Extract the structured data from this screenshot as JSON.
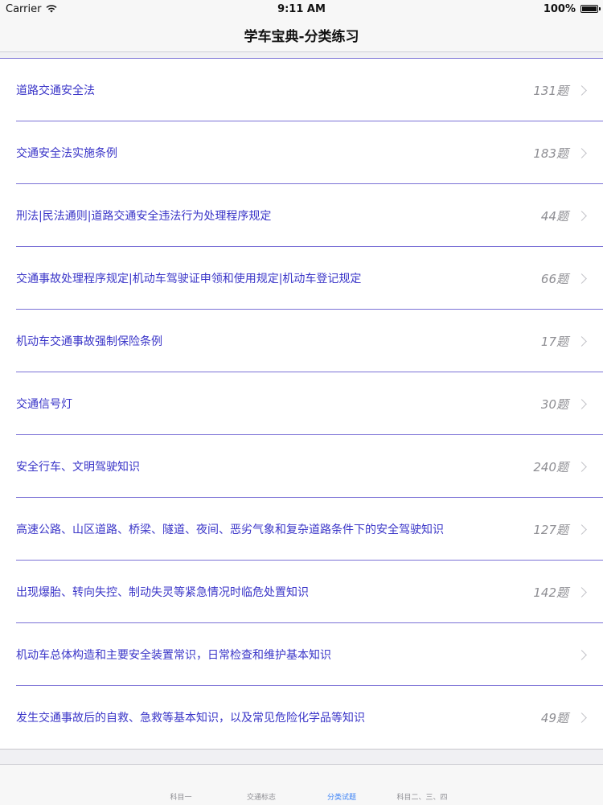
{
  "statusbar": {
    "carrier": "Carrier",
    "time": "9:11 AM",
    "battery": "100%"
  },
  "navbar": {
    "title": "学车宝典-分类练习"
  },
  "list": {
    "items": [
      {
        "label": "道路交通安全法",
        "count": "131题"
      },
      {
        "label": "交通安全法实施条例",
        "count": "183题"
      },
      {
        "label": "刑法|民法通则|道路交通安全违法行为处理程序规定",
        "count": "44题"
      },
      {
        "label": "交通事故处理程序规定|机动车驾驶证申领和使用规定|机动车登记规定",
        "count": "66题"
      },
      {
        "label": "机动车交通事故强制保险条例",
        "count": "17题"
      },
      {
        "label": "交通信号灯",
        "count": "30题"
      },
      {
        "label": "安全行车、文明驾驶知识",
        "count": "240题"
      },
      {
        "label": "高速公路、山区道路、桥梁、隧道、夜间、恶劣气象和复杂道路条件下的安全驾驶知识",
        "count": "127题"
      },
      {
        "label": "出现爆胎、转向失控、制动失灵等紧急情况时临危处置知识",
        "count": "142题"
      },
      {
        "label": "机动车总体构造和主要安全装置常识，日常检查和维护基本知识",
        "count": ""
      },
      {
        "label": "发生交通事故后的自救、急救等基本知识，以及常见危险化学品等知识",
        "count": "49题"
      }
    ]
  },
  "tabbar": {
    "tabs": [
      {
        "label": "科目一"
      },
      {
        "label": "交通标志"
      },
      {
        "label": "分类试题"
      },
      {
        "label": "科目二、三、四"
      }
    ]
  },
  "colors": {
    "accent": "#3a35c8",
    "separator": "#7b72d6",
    "tab_active": "#3b82f6"
  }
}
